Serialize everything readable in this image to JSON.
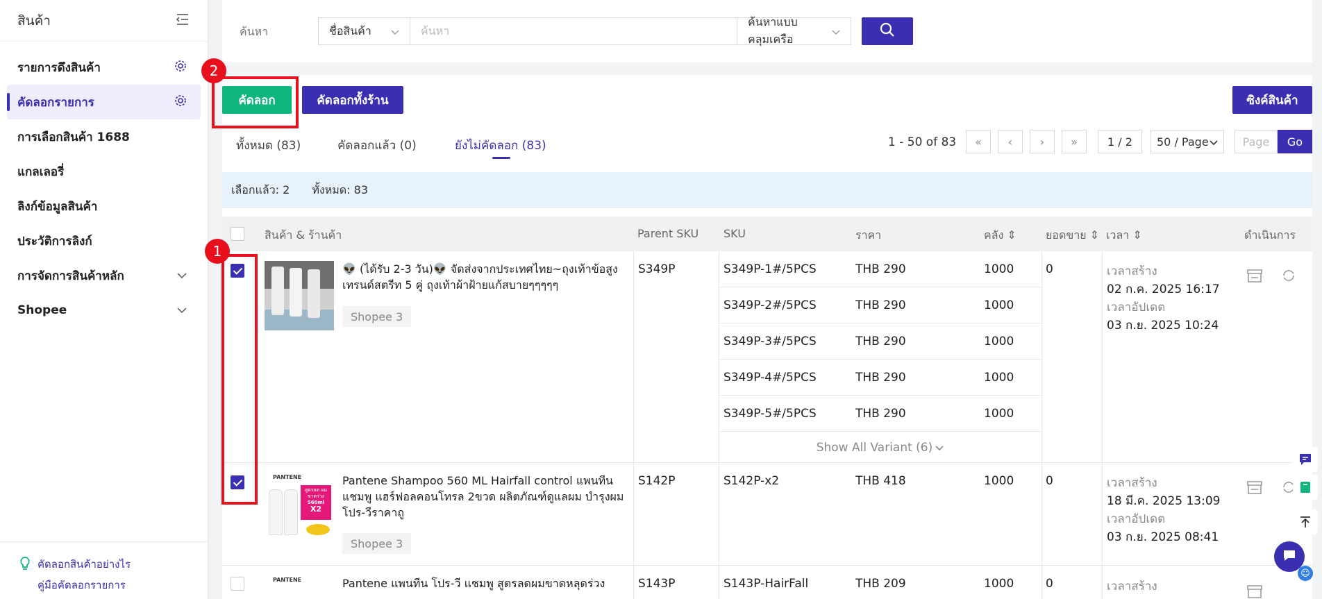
{
  "sidebar": {
    "title": "สินค้า",
    "items": [
      {
        "label": "รายการดึงสินค้า"
      },
      {
        "label": "คัดลอกรายการ"
      },
      {
        "label": "การเลือกสินค้า 1688"
      },
      {
        "label": "แกลเลอรี่"
      },
      {
        "label": "ลิงก์ข้อมูลสินค้า"
      },
      {
        "label": "ประวัติการลิงก์"
      },
      {
        "label": "การจัดการสินค้าหลัก"
      },
      {
        "label": "Shopee"
      }
    ],
    "footer_links": [
      "คัดลอกสินค้าอย่างไร",
      "คู่มือคัดลอกรายการ"
    ]
  },
  "search": {
    "label": "ค้นหา",
    "field_select": "ชื่อสินค้า",
    "placeholder": "ค้นหา",
    "mode_select": "ค้นหาแบบคลุมเครือ"
  },
  "toolbar": {
    "copy_label": "คัดลอก",
    "copy_all_label": "คัดลอกทั้งร้าน",
    "sync_label": "ซิงค์สินค้า"
  },
  "tabs": [
    {
      "label": "ทั้งหมด (83)"
    },
    {
      "label": "คัดลอกแล้ว (0)"
    },
    {
      "label": "ยังไม่คัดลอก (83)"
    }
  ],
  "pagination": {
    "range": "1 - 50 of 83",
    "page": "1 / 2",
    "page_size": "50 / Page",
    "page_placeholder": "Page",
    "go_label": "Go"
  },
  "selection": {
    "selected": "เลือกแล้ว: 2",
    "total": "ทั้งหมด: 83"
  },
  "table": {
    "headers": {
      "product": "สินค้า & ร้านค้า",
      "parent_sku": "Parent SKU",
      "sku": "SKU",
      "price": "ราคา",
      "stock": "คลัง",
      "sales": "ยอดขาย",
      "time": "เวลา",
      "actions": "ดำเนินการ"
    },
    "rows": [
      {
        "title": "👽 (ได้รับ 2-3 วัน)👽 จัดส่งจากประเทศไทย~ถุงเท้าข้อสูงเทรนด์สตรีท 5 คู่ ถุงเท้าผ้าฝ้ายแก้สบายๆๆๆๆๆ",
        "shop": "Shopee 3",
        "parent_sku": "S349P",
        "variants": [
          {
            "sku": "S349P-1#/5PCS",
            "price": "THB 290",
            "stock": "1000"
          },
          {
            "sku": "S349P-2#/5PCS",
            "price": "THB 290",
            "stock": "1000"
          },
          {
            "sku": "S349P-3#/5PCS",
            "price": "THB 290",
            "stock": "1000"
          },
          {
            "sku": "S349P-4#/5PCS",
            "price": "THB 290",
            "stock": "1000"
          },
          {
            "sku": "S349P-5#/5PCS",
            "price": "THB 290",
            "stock": "1000"
          }
        ],
        "show_all": "Show All Variant (6)",
        "sales": "0",
        "created_label": "เวลาสร้าง",
        "created": "02 ก.ค. 2025 16:17",
        "updated_label": "เวลาอัปเดต",
        "updated": "03 ก.ย. 2025 10:24"
      },
      {
        "title": "Pantene Shampoo 560 ML Hairfall control แพนทีน แชมพู แฮร์ฟอลคอนโทรล 2ขวด ผลิตภัณฑ์ดูแลผม บำรุงผม โปร-วีราคาถู",
        "shop": "Shopee 3",
        "parent_sku": "S142P",
        "sku": "S142P-x2",
        "price": "THB 418",
        "stock": "1000",
        "sales": "0",
        "created_label": "เวลาสร้าง",
        "created": "18 มี.ค. 2025 13:09",
        "updated_label": "เวลาอัปเดต",
        "updated": "03 ก.ย. 2025 08:41",
        "image_text": {
          "brand": "PANTENE",
          "promo": "สูตรลด ผมขาดร่วง",
          "size": "560ml",
          "mult": "X2"
        }
      },
      {
        "title": "Pantene แพนทีน โปร-วี แชมพู สูตรลดผมขาดหลุดร่วง",
        "parent_sku": "S143P",
        "sku": "S143P-HairFall",
        "price": "THB 209",
        "stock": "1000",
        "sales": "0",
        "created_label": "เวลาสร้าง",
        "image_text": {
          "brand": "PANTENE"
        }
      }
    ]
  },
  "annotations": {
    "one": "1",
    "two": "2"
  },
  "colors": {
    "primary": "#3a2fb0",
    "green": "#0fb57c",
    "annotation": "#e8101c"
  }
}
